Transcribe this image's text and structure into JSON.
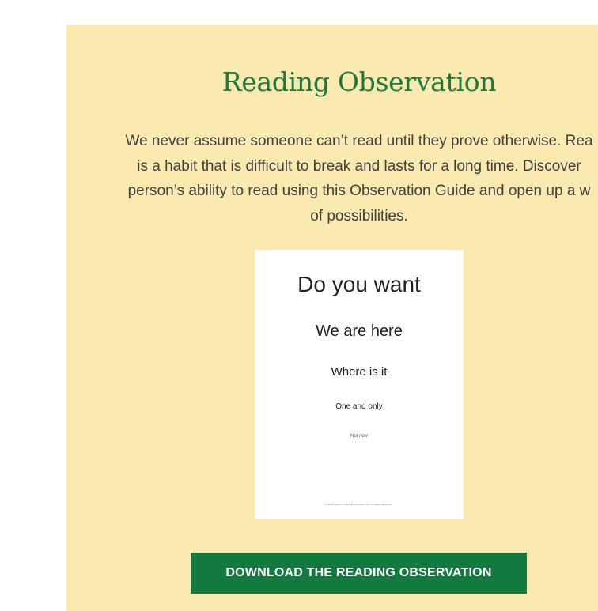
{
  "section": {
    "title": "Reading Observation",
    "description_lines": [
      "We never assume someone can’t read until they prove otherwise. Rea",
      "is a habit that is difficult to break and lasts for a long time. Discover",
      "person’s ability to read using this Observation Guide and open up a w",
      "of possibilities."
    ]
  },
  "preview": {
    "line1": "Do you want",
    "line2": "We are here",
    "line3": "Where is it",
    "line4": "One and only",
    "line5": "Not now",
    "footer": "© 2016 Lauren J. Hope & Associates, LLC. All Rights Reserved."
  },
  "download_button": {
    "label": "DOWNLOAD THE READING OBSERVATION"
  },
  "colors": {
    "panel_bg": "#faeab0",
    "title": "#1c7a3e",
    "button_bg": "#137a3f",
    "button_text": "#ffffff"
  }
}
